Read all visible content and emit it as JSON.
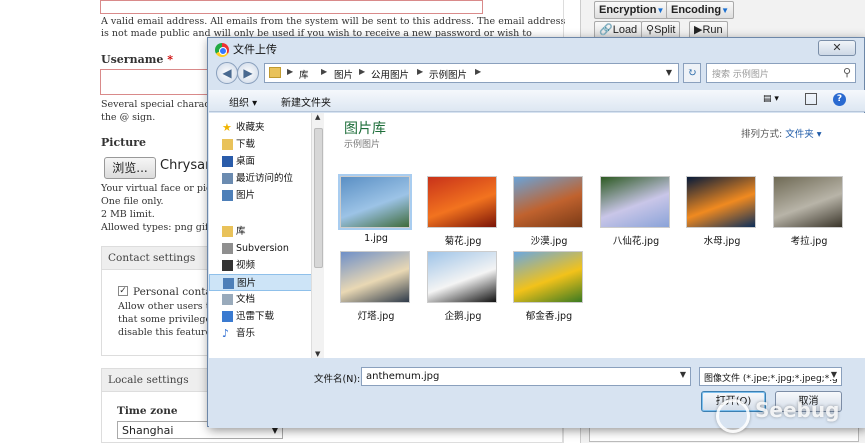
{
  "page": {
    "email_desc": "A valid email address. All emails from the system will be sent to this address. The email address is not made public and will only be used if you wish to receive a new password or wish to receive certain news or notifications by email.",
    "username_label": "Username",
    "required_mark": "*",
    "username_desc_1": "Several special characters a",
    "username_desc_2": "the @ sign.",
    "picture_label": "Picture",
    "browse_label": "浏览...",
    "browse_file": "Chrysan",
    "picture_desc_1": "Your virtual face or picture",
    "picture_desc_2": "One file only.",
    "picture_desc_3": "2 MB limit.",
    "picture_desc_4": "Allowed types: png gif jpg j",
    "contact_title": "Contact settings",
    "personal_contact": "Personal contact",
    "contact_desc_1": "Allow other users to co",
    "contact_desc_2": "that some privileged u",
    "contact_desc_3": "disable this feature.",
    "locale_title": "Locale settings",
    "timezone_label": "Time zone",
    "timezone_value": "Shanghai"
  },
  "hackbar": {
    "encryption": "Encryption",
    "encoding": "Encoding",
    "load": "Load",
    "split": "Split",
    "run": "Run"
  },
  "dialog": {
    "title": "文件上传",
    "close": "✕",
    "breadcrumbs": [
      "库",
      "图片",
      "公用图片",
      "示例图片"
    ],
    "search_placeholder": "搜索 示例图片",
    "toolbar": {
      "organize": "组织 ▾",
      "new_folder": "新建文件夹"
    },
    "tree": [
      {
        "label": "收藏夹",
        "icon": "star-icon"
      },
      {
        "label": "下载",
        "icon": "download-folder-icon"
      },
      {
        "label": "桌面",
        "icon": "desktop-icon"
      },
      {
        "label": "最近访问的位",
        "icon": "recent-icon"
      },
      {
        "label": "图片",
        "icon": "pictures-icon"
      },
      {
        "label": "库",
        "icon": "library-icon"
      },
      {
        "label": "Subversion",
        "icon": "svn-icon"
      },
      {
        "label": "视频",
        "icon": "video-icon"
      },
      {
        "label": "图片",
        "icon": "pictures-icon"
      },
      {
        "label": "文档",
        "icon": "document-icon"
      },
      {
        "label": "迅雷下载",
        "icon": "thunder-icon"
      },
      {
        "label": "音乐",
        "icon": "music-icon"
      }
    ],
    "library_title": "图片库",
    "library_subtitle": "示例图片",
    "sort_label": "排列方式:",
    "sort_value": "文件夹 ▾",
    "files": [
      {
        "name": "1.jpg",
        "colors": [
          "#5a8fc4",
          "#9cc3e6",
          "#3f6b3a"
        ]
      },
      {
        "name": "菊花.jpg",
        "colors": [
          "#c8321a",
          "#f2731f",
          "#7a1408"
        ]
      },
      {
        "name": "沙漠.jpg",
        "colors": [
          "#6aa3d8",
          "#c0622e",
          "#7a3a16"
        ]
      },
      {
        "name": "八仙花.jpg",
        "colors": [
          "#2d5a22",
          "#c9c6e8",
          "#8aa3d8"
        ]
      },
      {
        "name": "水母.jpg",
        "colors": [
          "#061a3a",
          "#f08a20",
          "#0c2e5a"
        ]
      },
      {
        "name": "考拉.jpg",
        "colors": [
          "#6f6a55",
          "#b8b4a8",
          "#3a352a"
        ]
      },
      {
        "name": "灯塔.jpg",
        "colors": [
          "#6e8fc8",
          "#e9d8b4",
          "#2e3a4a"
        ]
      },
      {
        "name": "企鹅.jpg",
        "colors": [
          "#9fc4e8",
          "#f4f4f4",
          "#111111"
        ]
      },
      {
        "name": "郁金香.jpg",
        "colors": [
          "#6aa7e0",
          "#f2c21a",
          "#3a7a22"
        ]
      }
    ],
    "filename_label": "文件名(N):",
    "filename_value": "anthemum.jpg",
    "filetype_value": "图像文件 (*.jpe;*.jpg;*.jpeg;*.g",
    "open_button": "打开(O)",
    "cancel_button": "取消"
  },
  "watermark": "Seebug"
}
